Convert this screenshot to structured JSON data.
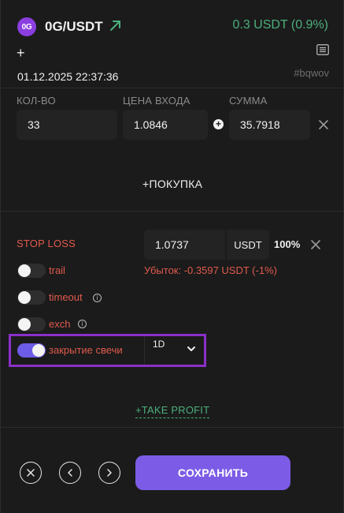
{
  "header": {
    "coin_logo_text": "0G",
    "pair": "0G/USDT",
    "pnl": "0.3 USDT (0.9%)",
    "datetime": "01.12.2025 22:37:36",
    "tag": "#bqwov"
  },
  "order": {
    "qty_label": "КОЛ-ВО",
    "price_label": "ЦЕНА ВХОДА",
    "sum_label": "СУММА",
    "qty_value": "33",
    "price_value": "1.0846",
    "sum_value": "35.7918",
    "buy_label": "+ПОКУПКА"
  },
  "stop_loss": {
    "label": "STOP LOSS",
    "price": "1.0737",
    "unit": "USDT",
    "percent": "100%",
    "loss_text": "Убыток: -0.3597 USDT (-1%)",
    "toggles": [
      {
        "label": "trail",
        "on": false
      },
      {
        "label": "timeout",
        "on": false
      },
      {
        "label": "exch",
        "on": false
      },
      {
        "label": "закрытие свечи",
        "on": true
      }
    ],
    "timeframe": "1D"
  },
  "take_profit": {
    "label": "+TAKE PROFIT"
  },
  "footer": {
    "save_label": "СОХРАНИТЬ"
  },
  "colors": {
    "accent": "#7c5ce6",
    "profit": "#4caf7d",
    "loss": "#e05a4c",
    "highlight": "#8b2fc9"
  }
}
